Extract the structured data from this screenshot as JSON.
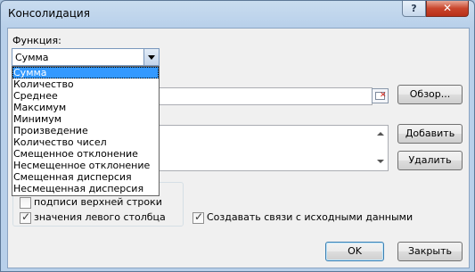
{
  "window": {
    "title": "Консолидация",
    "help_label": "?",
    "close_label": "✕"
  },
  "function": {
    "label": "Функция:",
    "selected": "Сумма",
    "options": [
      "Сумма",
      "Количество",
      "Среднее",
      "Максимум",
      "Минимум",
      "Произведение",
      "Количество чисел",
      "Смещенное отклонение",
      "Несмещенное отклонение",
      "Смещенная дисперсия",
      "Несмещенная дисперсия"
    ]
  },
  "buttons": {
    "browse": "Обзор...",
    "add": "Добавить",
    "delete": "Удалить",
    "ok": "OK",
    "close": "Закрыть"
  },
  "checkboxes": {
    "top_row": {
      "label": "подписи верхней строки",
      "checked": false
    },
    "left_column": {
      "label": "значения левого столбца",
      "checked": true
    },
    "create_links": {
      "label": "Создавать связи с исходными данными",
      "checked": true
    }
  },
  "icons": {
    "collapse_dialog": "range-select-icon",
    "scroll_up": "scroll-up-icon",
    "scroll_down": "scroll-down-icon",
    "checkmark": "checkmark-icon"
  },
  "colors": {
    "selection": "#3399ff",
    "close_button": "#c9452c"
  }
}
